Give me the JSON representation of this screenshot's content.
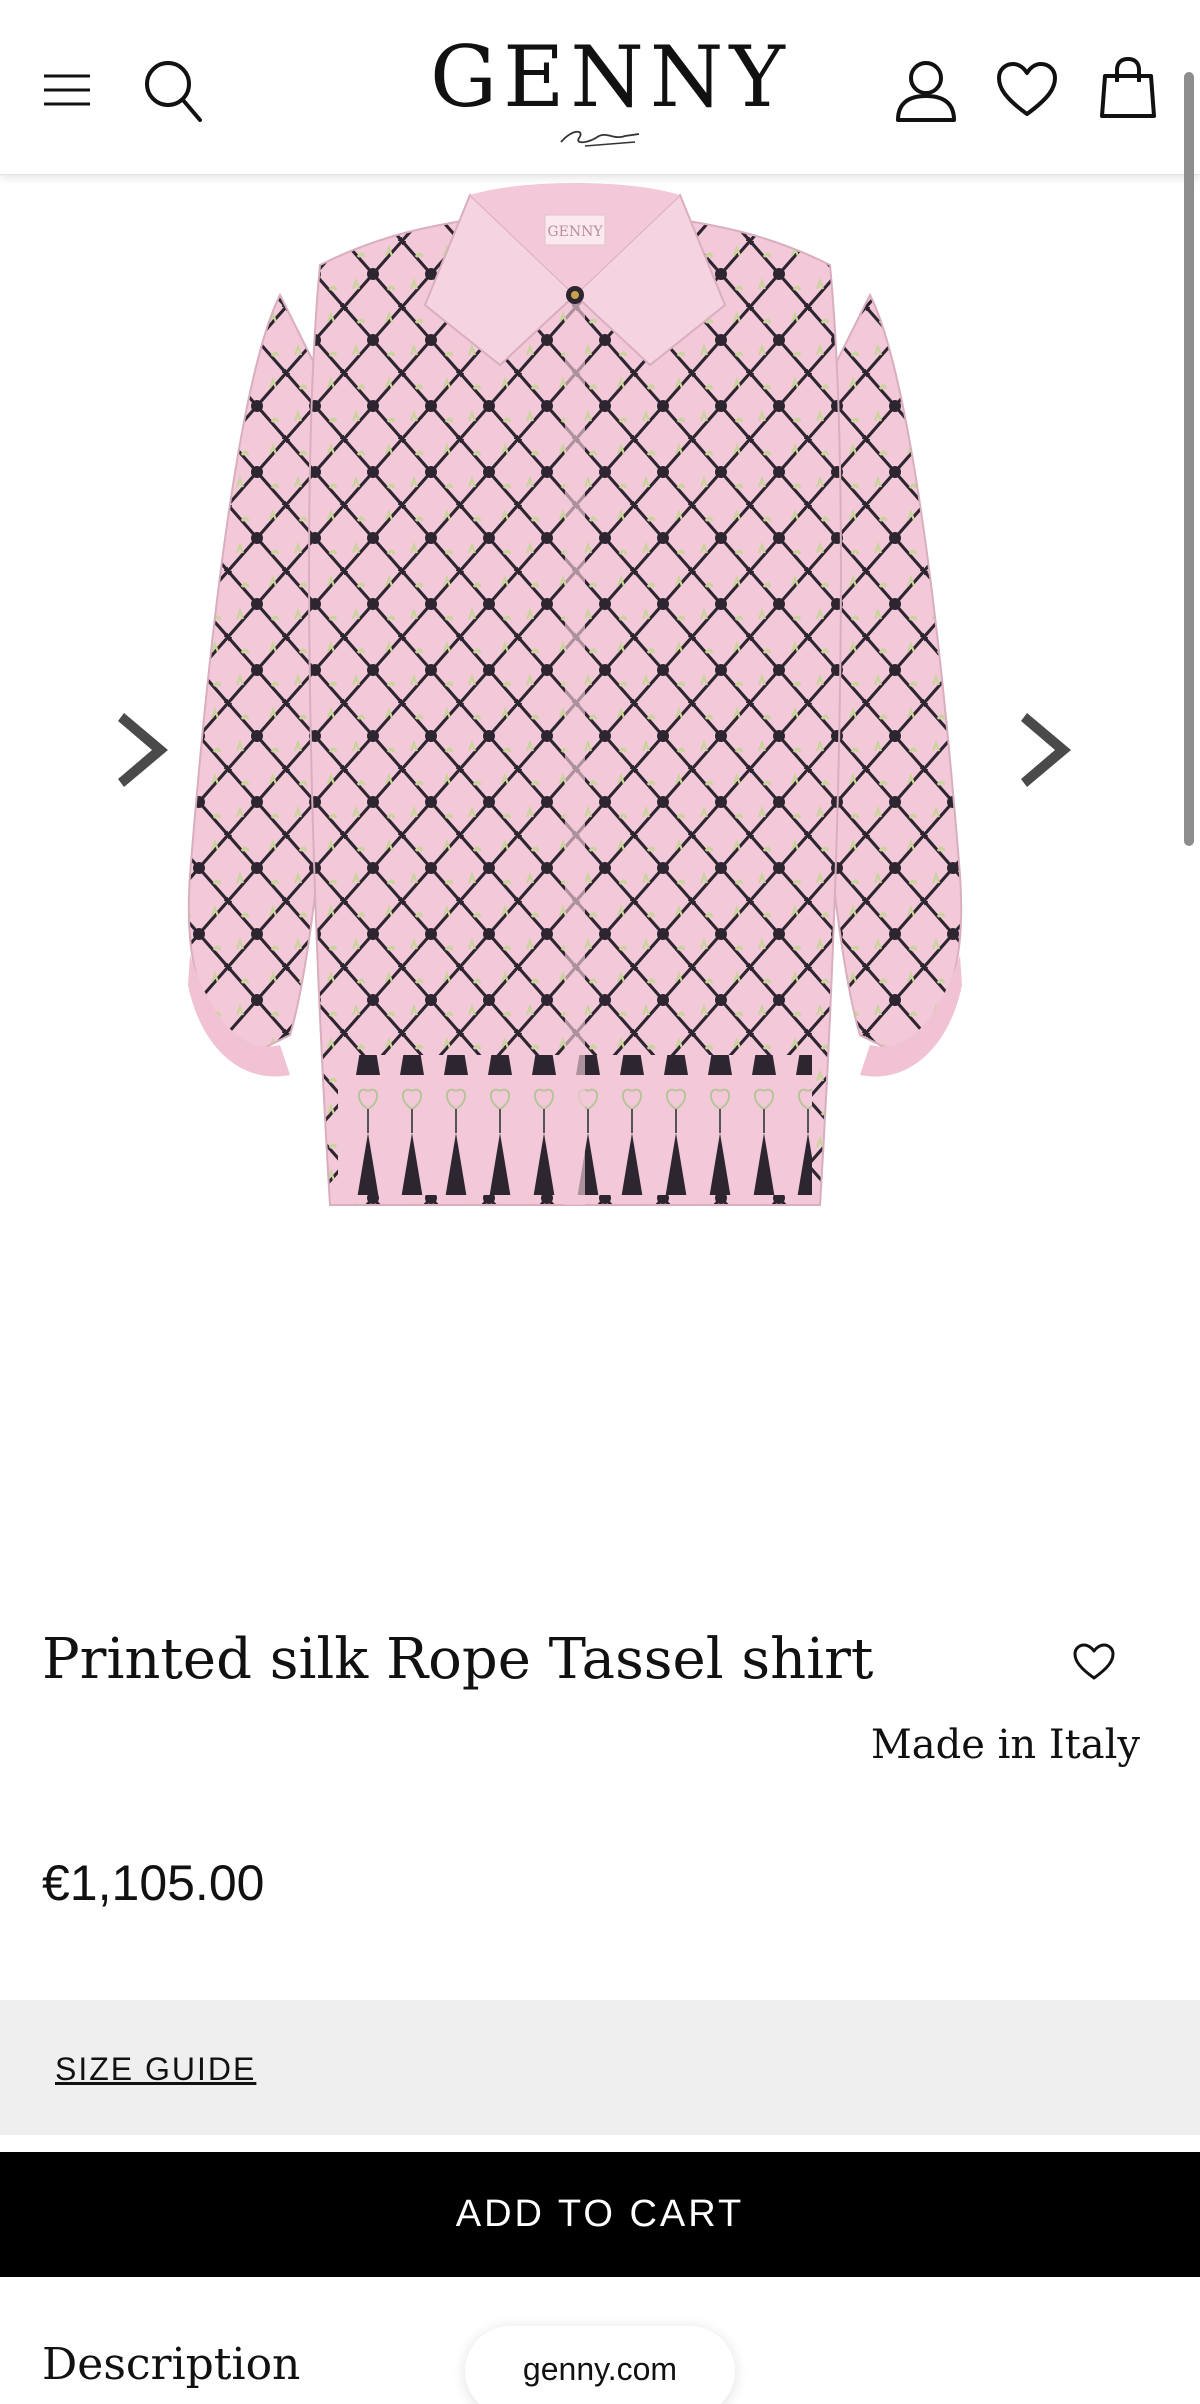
{
  "header": {
    "brand": "GENNY",
    "icons": [
      "menu-icon",
      "search-icon",
      "account-icon",
      "heart-icon",
      "bag-icon"
    ]
  },
  "product": {
    "title": "Printed silk Rope Tassel shirt",
    "origin": "Made in Italy",
    "price": "€1,105.00",
    "image_label": "GENNY",
    "colors": {
      "fabric": "#f3c9d9",
      "rope": "#2d2530",
      "accent": "#c9d49a"
    }
  },
  "actions": {
    "size_guide": "SIZE GUIDE",
    "add_to_cart": "ADD TO CART"
  },
  "sections": {
    "description": "Description"
  },
  "browser": {
    "url": "genny.com"
  }
}
